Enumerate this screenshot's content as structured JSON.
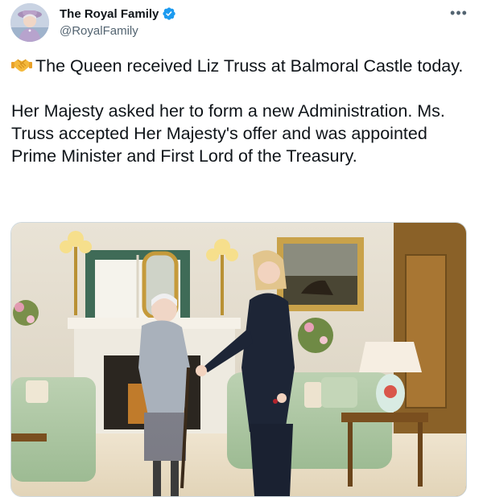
{
  "account": {
    "display_name": "The Royal Family",
    "handle": "@RoyalFamily",
    "avatar_icon": "avatar-photo-queen",
    "verified_icon": "verified-badge-icon",
    "verified_color": "#1d9bf0"
  },
  "menu": {
    "more_label": "•••"
  },
  "tweet": {
    "paragraph_1": "The Queen received Liz Truss at Balmoral Castle today.",
    "paragraph_2": "Her Majesty asked her to form a new Administration. Ms. Truss accepted Her Majesty's offer and was appointed Prime Minister and First Lord of the Treasury.",
    "leading_emoji_icon": "handshake-emoji-icon"
  },
  "media": {
    "icon": "photo-queen-and-prime-minister-handshake-drawing-room"
  }
}
